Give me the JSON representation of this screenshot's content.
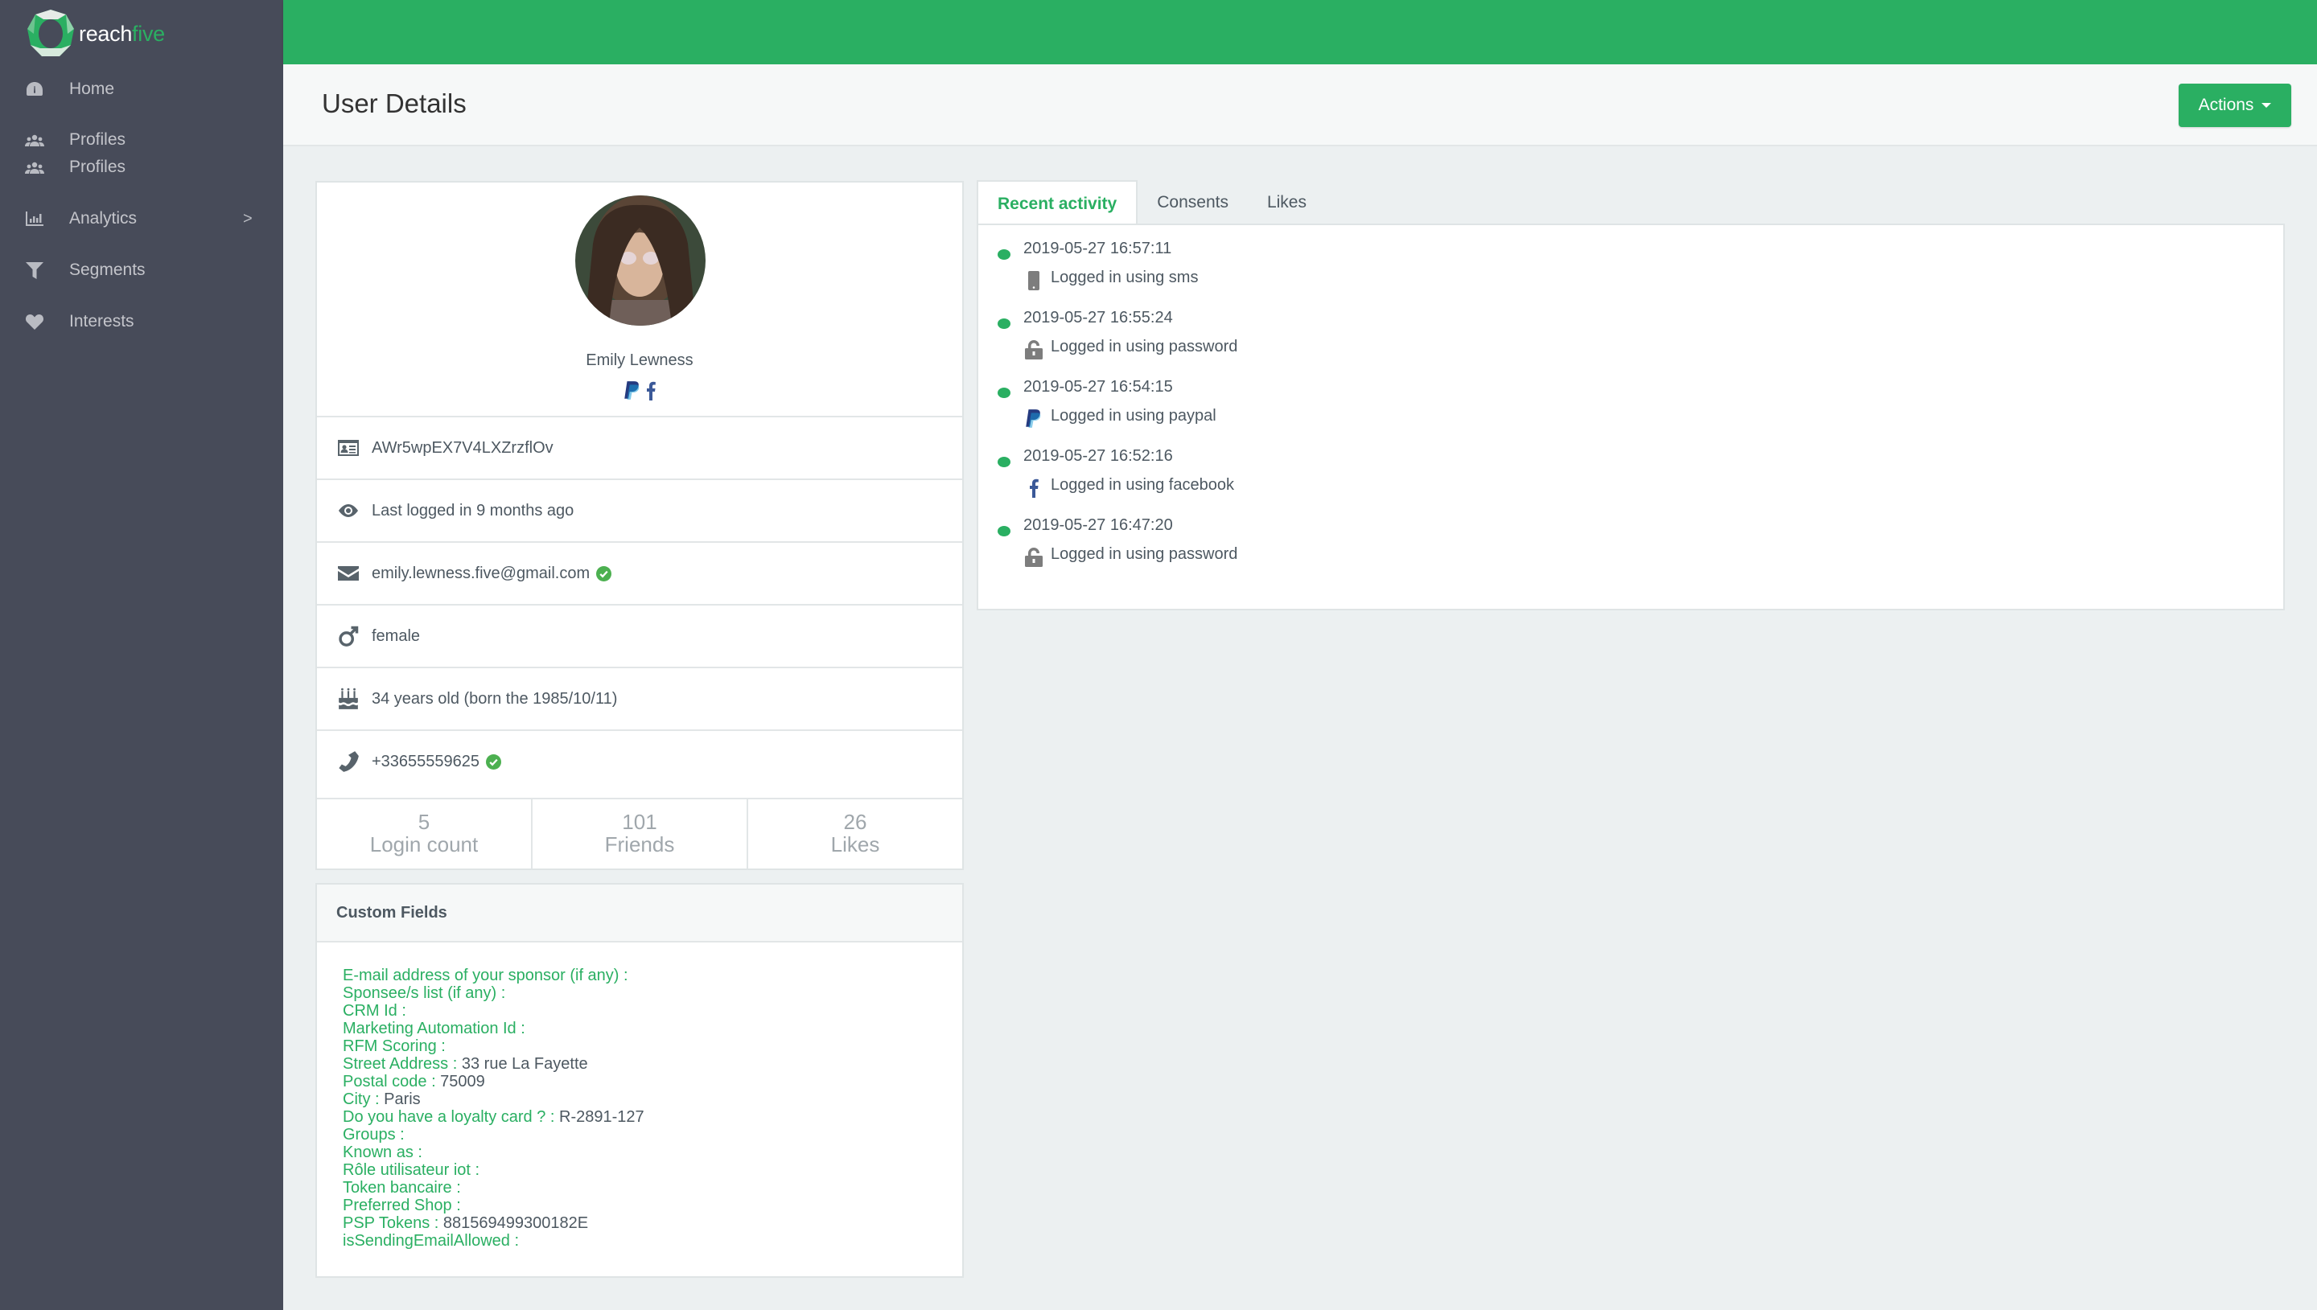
{
  "brand": {
    "name_part1": "reach",
    "name_part2": "five"
  },
  "sidebar": {
    "items": [
      {
        "label": "Home",
        "icon": "dashboard-icon"
      },
      {
        "label": "Profiles",
        "icon": "users-icon"
      },
      {
        "label": "Profiles",
        "icon": "users-icon"
      },
      {
        "label": "Analytics",
        "icon": "bar-chart-icon",
        "chevron": ">"
      },
      {
        "label": "Segments",
        "icon": "filter-icon"
      },
      {
        "label": "Interests",
        "icon": "heart-icon"
      }
    ]
  },
  "header": {
    "title": "User Details",
    "actions_label": "Actions"
  },
  "profile": {
    "name": "Emily Lewness",
    "providers": [
      "paypal",
      "facebook"
    ],
    "id": "AWr5wpEX7V4LXZrzflOv",
    "last_login": "Last logged in 9 months ago",
    "email": "emily.lewness.five@gmail.com",
    "email_verified": true,
    "gender": "female",
    "age": "34 years old (born the 1985/10/11)",
    "phone": "+33655559625",
    "phone_verified": true,
    "stats": [
      {
        "value": "5",
        "label": "Login count"
      },
      {
        "value": "101",
        "label": "Friends"
      },
      {
        "value": "26",
        "label": "Likes"
      }
    ]
  },
  "custom_fields": {
    "title": "Custom Fields",
    "rows": [
      {
        "key": "E-mail address of your sponsor (if any) :",
        "value": ""
      },
      {
        "key": "Sponsee/s list (if any) :",
        "value": ""
      },
      {
        "key": "CRM Id :",
        "value": ""
      },
      {
        "key": "Marketing Automation Id :",
        "value": ""
      },
      {
        "key": "RFM Scoring :",
        "value": ""
      },
      {
        "key": "Street Address :",
        "value": " 33 rue La Fayette"
      },
      {
        "key": "Postal code :",
        "value": " 75009"
      },
      {
        "key": "City :",
        "value": " Paris"
      },
      {
        "key": "Do you have a loyalty card ? :",
        "value": " R-2891-127"
      },
      {
        "key": "Groups :",
        "value": ""
      },
      {
        "key": "Known as :",
        "value": ""
      },
      {
        "key": "Rôle utilisateur iot :",
        "value": ""
      },
      {
        "key": "Token bancaire :",
        "value": ""
      },
      {
        "key": "Preferred Shop :",
        "value": ""
      },
      {
        "key": "PSP Tokens :",
        "value": " 881569499300182E"
      },
      {
        "key": "isSendingEmailAllowed :",
        "value": ""
      }
    ]
  },
  "activity": {
    "tabs": [
      {
        "label": "Recent activity",
        "active": true
      },
      {
        "label": "Consents",
        "active": false
      },
      {
        "label": "Likes",
        "active": false
      }
    ],
    "items": [
      {
        "time": "2019-05-27 16:57:11",
        "desc": "Logged in using sms",
        "icon": "mobile-icon"
      },
      {
        "time": "2019-05-27 16:55:24",
        "desc": "Logged in using password",
        "icon": "unlock-icon"
      },
      {
        "time": "2019-05-27 16:54:15",
        "desc": "Logged in using paypal",
        "icon": "paypal-icon"
      },
      {
        "time": "2019-05-27 16:52:16",
        "desc": "Logged in using facebook",
        "icon": "facebook-icon"
      },
      {
        "time": "2019-05-27 16:47:20",
        "desc": "Logged in using password",
        "icon": "unlock-icon"
      }
    ]
  },
  "colors": {
    "accent": "#2aaf62",
    "sidebar": "#474b59",
    "paypal": "#253b80",
    "facebook": "#3b5998",
    "verified": "#4cb050"
  }
}
